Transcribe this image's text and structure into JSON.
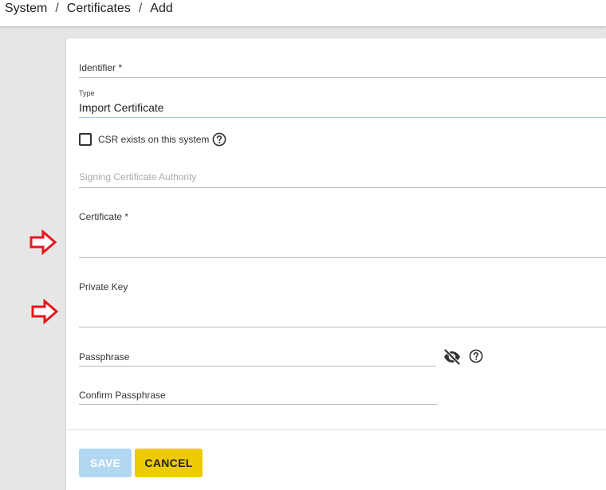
{
  "breadcrumb": {
    "items": [
      "System",
      "Certificates",
      "Add"
    ],
    "separator": "/"
  },
  "form": {
    "identifier": {
      "label": "Identifier *",
      "value": ""
    },
    "type": {
      "label": "Type",
      "value": "Import Certificate"
    },
    "csr_exists": {
      "label": "CSR exists on this system",
      "checked": false
    },
    "signing_authority": {
      "placeholder": "Signing Certificate Authority",
      "value": ""
    },
    "certificate": {
      "label": "Certificate *",
      "value": ""
    },
    "private_key": {
      "label": "Private Key",
      "value": ""
    },
    "passphrase": {
      "label": "Passphrase",
      "value": ""
    },
    "confirm_passphrase": {
      "label": "Confirm Passphrase",
      "value": ""
    }
  },
  "buttons": {
    "save": "SAVE",
    "cancel": "CANCEL"
  },
  "icons": {
    "help": "help-circle-icon",
    "visibility": "eye-off-icon",
    "annotation": "red-arrow-icon"
  },
  "colors": {
    "accent_underline": "#9ecde9",
    "save_disabled": "#b2d8f1",
    "cancel": "#eccc00",
    "annotation_arrow": "#e8161b",
    "canvas_background": "#e6e6e6"
  }
}
